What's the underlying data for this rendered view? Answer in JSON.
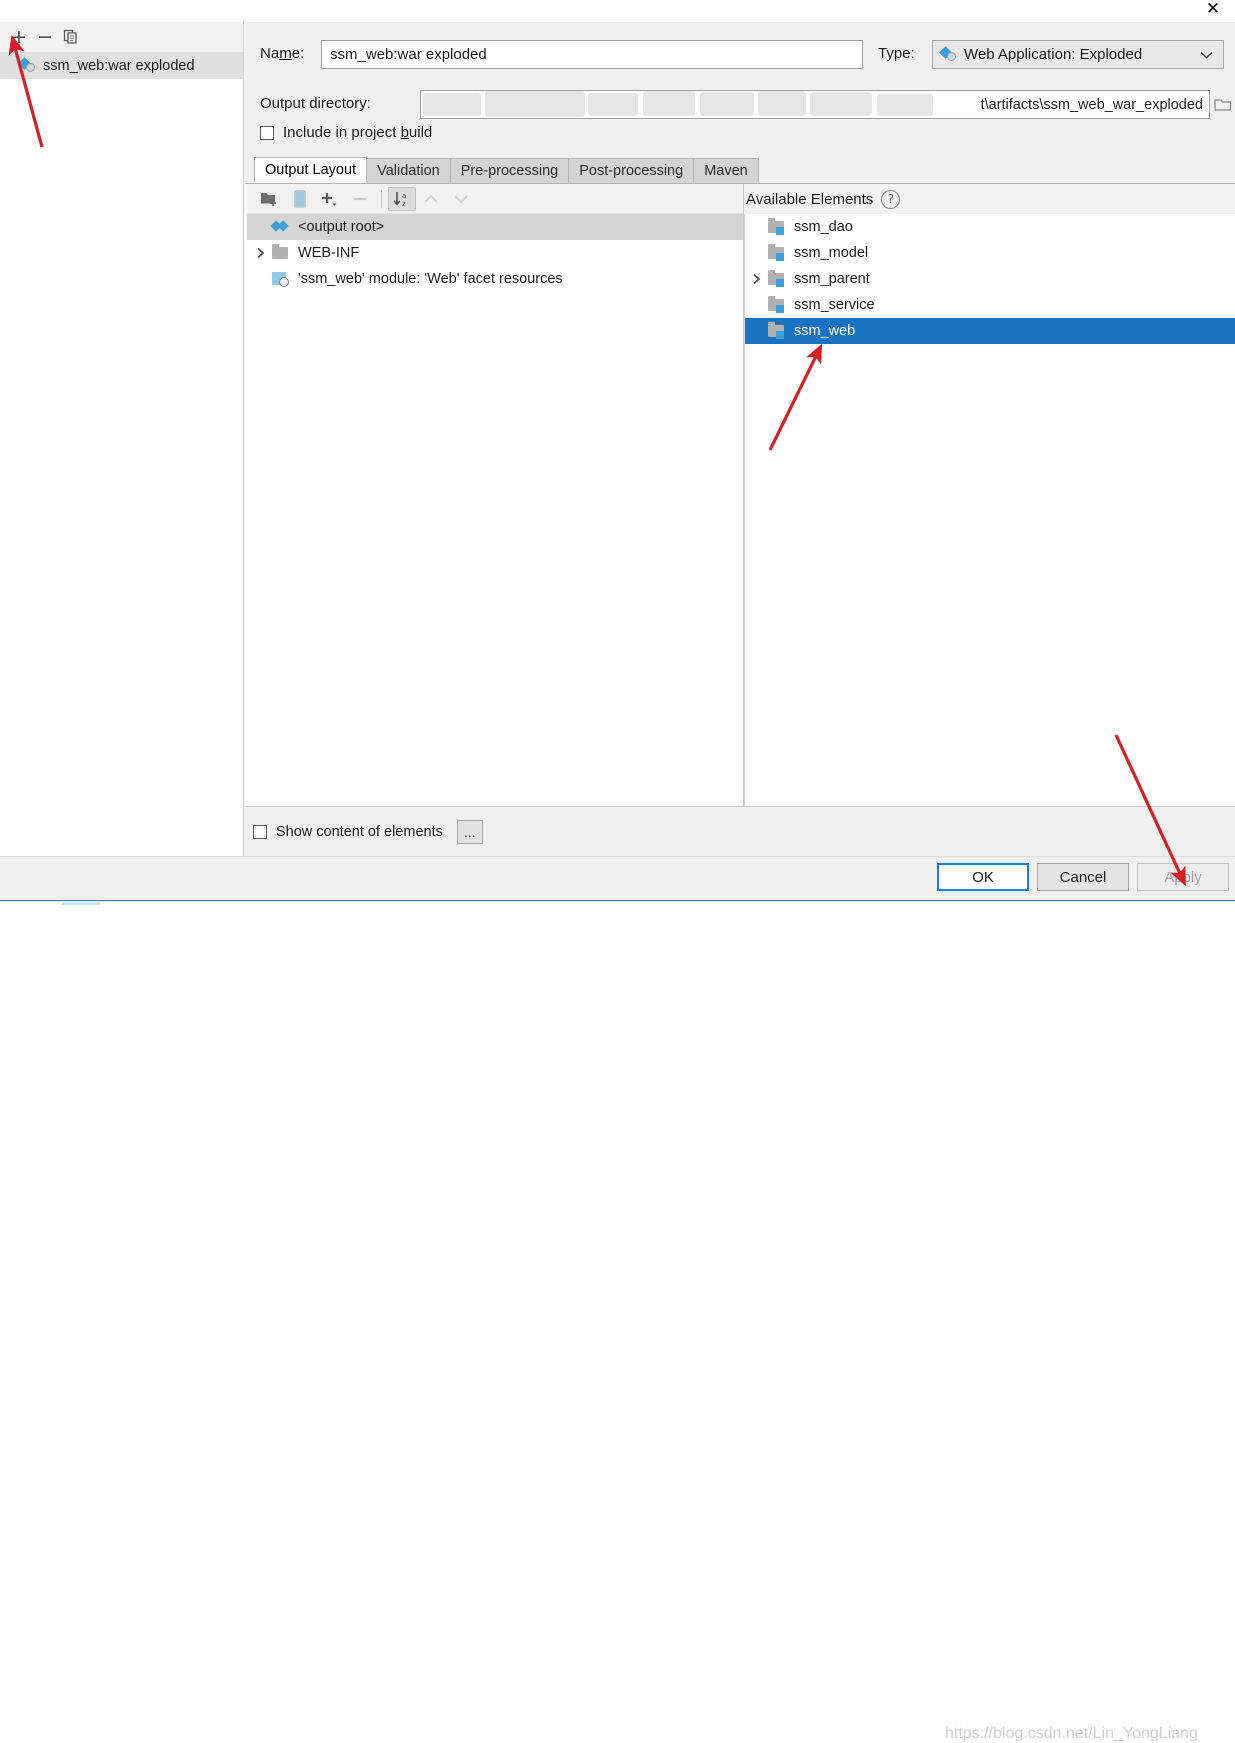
{
  "window": {
    "close_label": "✕"
  },
  "sidebar": {
    "toolbar": {
      "add_label": "+",
      "remove_label": "−",
      "copy_label": "copy-icon"
    },
    "items": [
      {
        "label": "ssm_web:war exploded",
        "selected": true
      }
    ]
  },
  "form": {
    "name_label": "Na",
    "name_label_mnemonic": "m",
    "name_label_rest": "e:",
    "name_value": "ssm_web:war exploded",
    "type_label": "Type:",
    "type_value": "Web Application: Exploded",
    "type_chevron": "⌄",
    "outdir_label": "Output directory:",
    "outdir_value": "t\\artifacts\\ssm_web_war_exploded",
    "outdir_browse_icon": "folder-icon",
    "include_checkbox_label_a": "Include in project ",
    "include_checkbox_label_mnemonic": "b",
    "include_checkbox_label_b": "uild",
    "include_checked": false
  },
  "tabs": [
    {
      "label": "Output Layout",
      "active": true
    },
    {
      "label": "Validation",
      "active": false
    },
    {
      "label": "Pre-processing",
      "active": false
    },
    {
      "label": "Post-processing",
      "active": false
    },
    {
      "label": "Maven",
      "active": false
    }
  ],
  "output_layout": {
    "toolbar": [
      {
        "name": "add-directory-icon",
        "enabled": true
      },
      {
        "name": "add-archive-icon",
        "enabled": true
      },
      {
        "name": "add-copy-of-icon",
        "enabled": true
      },
      {
        "name": "remove-icon",
        "enabled": false
      },
      {
        "name": "sort-alphabetically-icon",
        "enabled": true,
        "toggled": true
      },
      {
        "name": "move-up-icon",
        "enabled": false
      },
      {
        "name": "move-down-icon",
        "enabled": false
      }
    ],
    "tree": [
      {
        "label": "<output root>",
        "icon": "artifact-icon",
        "selected": true,
        "expandable": false,
        "level": 0
      },
      {
        "label": "WEB-INF",
        "icon": "folder-icon",
        "selected": false,
        "expandable": true,
        "level": 1
      },
      {
        "label": "'ssm_web' module: 'Web' facet resources",
        "icon": "web-facet-icon",
        "selected": false,
        "expandable": false,
        "level": 1
      }
    ]
  },
  "available_elements": {
    "title": "Available Elements",
    "help_icon": "?",
    "items": [
      {
        "label": "ssm_dao",
        "expandable": false,
        "selected": false
      },
      {
        "label": "ssm_model",
        "expandable": false,
        "selected": false
      },
      {
        "label": "ssm_parent",
        "expandable": true,
        "selected": false
      },
      {
        "label": "ssm_service",
        "expandable": false,
        "selected": false
      },
      {
        "label": "ssm_web",
        "expandable": false,
        "selected": true
      }
    ]
  },
  "footer": {
    "show_content_label": "Show content of elements",
    "show_content_checked": false,
    "more_button_label": "..."
  },
  "buttons": {
    "ok": "OK",
    "cancel": "Cancel",
    "apply": "Apply"
  },
  "watermark": {
    "text": "https://blog.csdn.net/Lin_YongLiang"
  },
  "colors": {
    "selection_blue": "#1673c0",
    "focus_border": "#1c7fd6",
    "annotation_red": "#d81f26",
    "dialog_bg": "#f0f0f0"
  }
}
